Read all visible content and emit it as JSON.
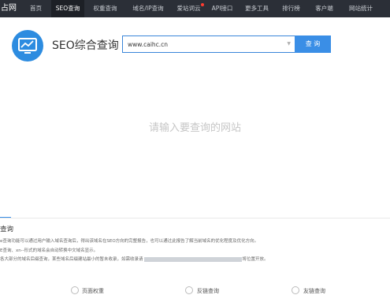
{
  "nav": {
    "brand": "占网",
    "items": [
      {
        "label": "首页"
      },
      {
        "label": "SEO查询",
        "active": true
      },
      {
        "label": "权重查询"
      },
      {
        "label": "域名/IP查询"
      },
      {
        "label": "爱站词云",
        "hot": true
      },
      {
        "label": "API接口"
      },
      {
        "label": "更多工具"
      },
      {
        "label": "排行榜"
      },
      {
        "label": "客户端"
      },
      {
        "label": "网站统计"
      }
    ]
  },
  "header": {
    "title": "SEO综合查询",
    "search_value": "www.caihc.cn",
    "search_button": "查 询"
  },
  "main": {
    "placeholder": "请输入要查询的网站"
  },
  "info": {
    "title": "查询",
    "line1": "e查询功能可以通过用户输入域名查询后，得出该域名在SEO方向的完整报告，也可以通过此报告了解当前域名的优化程度及优化方向。",
    "line2": "E查询、xn--形式的域名会自动转换中文域名显示。",
    "line3_start": "各大部分的域名后缀查询，某些域名后缀建站最小的暂未收录，如需收录请",
    "line3_end": "将位置开放。"
  },
  "bottom": {
    "item1": "页面权重",
    "item2": "反链查询",
    "item3": "友链查询"
  },
  "colors": {
    "nav_bg": "#2b2f37",
    "accent": "#3a8ee6",
    "logo": "#2d8ce0"
  }
}
